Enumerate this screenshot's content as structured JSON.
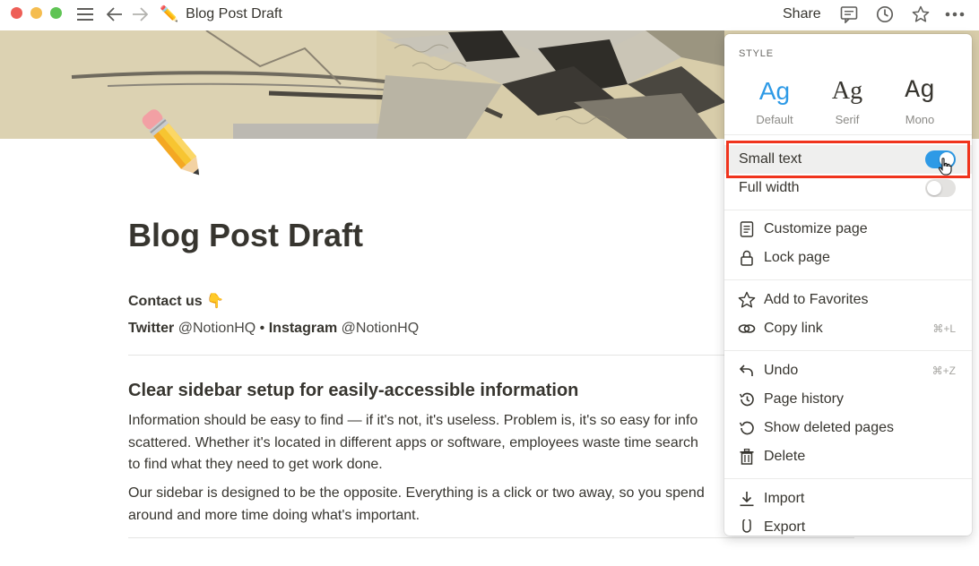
{
  "window": {
    "breadcrumb_emoji": "✏️",
    "breadcrumb_title": "Blog Post Draft",
    "share_label": "Share"
  },
  "page": {
    "icon_name": "pencil-icon",
    "title": "Blog Post Draft",
    "contact_heading": "Contact us",
    "contact_emoji": "👇",
    "twitter_label": "Twitter",
    "twitter_handle": "@NotionHQ",
    "separator": "•",
    "instagram_label": "Instagram",
    "instagram_handle": "@NotionHQ",
    "section_heading": "Clear sidebar setup for easily-accessible information",
    "para1_line1": "Information should be easy to find — if it's not, it's useless. Problem is, it's so easy for info",
    "para1_line2": "scattered. Whether it's located in different apps or software, employees waste time search",
    "para1_line3": "to find what they need to get work done.",
    "para2_line1": "Our sidebar is designed to be the opposite. Everything is a click or two away, so you spend",
    "para2_line2": "around and more time doing what's important."
  },
  "menu": {
    "style_label": "STYLE",
    "fonts": [
      {
        "glyph": "Ag",
        "label": "Default",
        "selected": true
      },
      {
        "glyph": "Ag",
        "label": "Serif",
        "selected": false
      },
      {
        "glyph": "Ag",
        "label": "Mono",
        "selected": false
      }
    ],
    "small_text": {
      "label": "Small text",
      "on": true
    },
    "full_width": {
      "label": "Full width",
      "on": false
    },
    "items": {
      "customize": "Customize page",
      "lock": "Lock page",
      "favorites": "Add to Favorites",
      "copy_link": "Copy link",
      "copy_link_shortcut": "⌘+L",
      "undo": "Undo",
      "undo_shortcut": "⌘+Z",
      "history": "Page history",
      "deleted": "Show deleted pages",
      "delete": "Delete",
      "import": "Import",
      "export": "Export"
    }
  },
  "colors": {
    "accent": "#2e9ae6",
    "toggle_on": "#2e9ae6",
    "toggle_off": "#e3e2e0",
    "highlight": "#f0341d"
  }
}
